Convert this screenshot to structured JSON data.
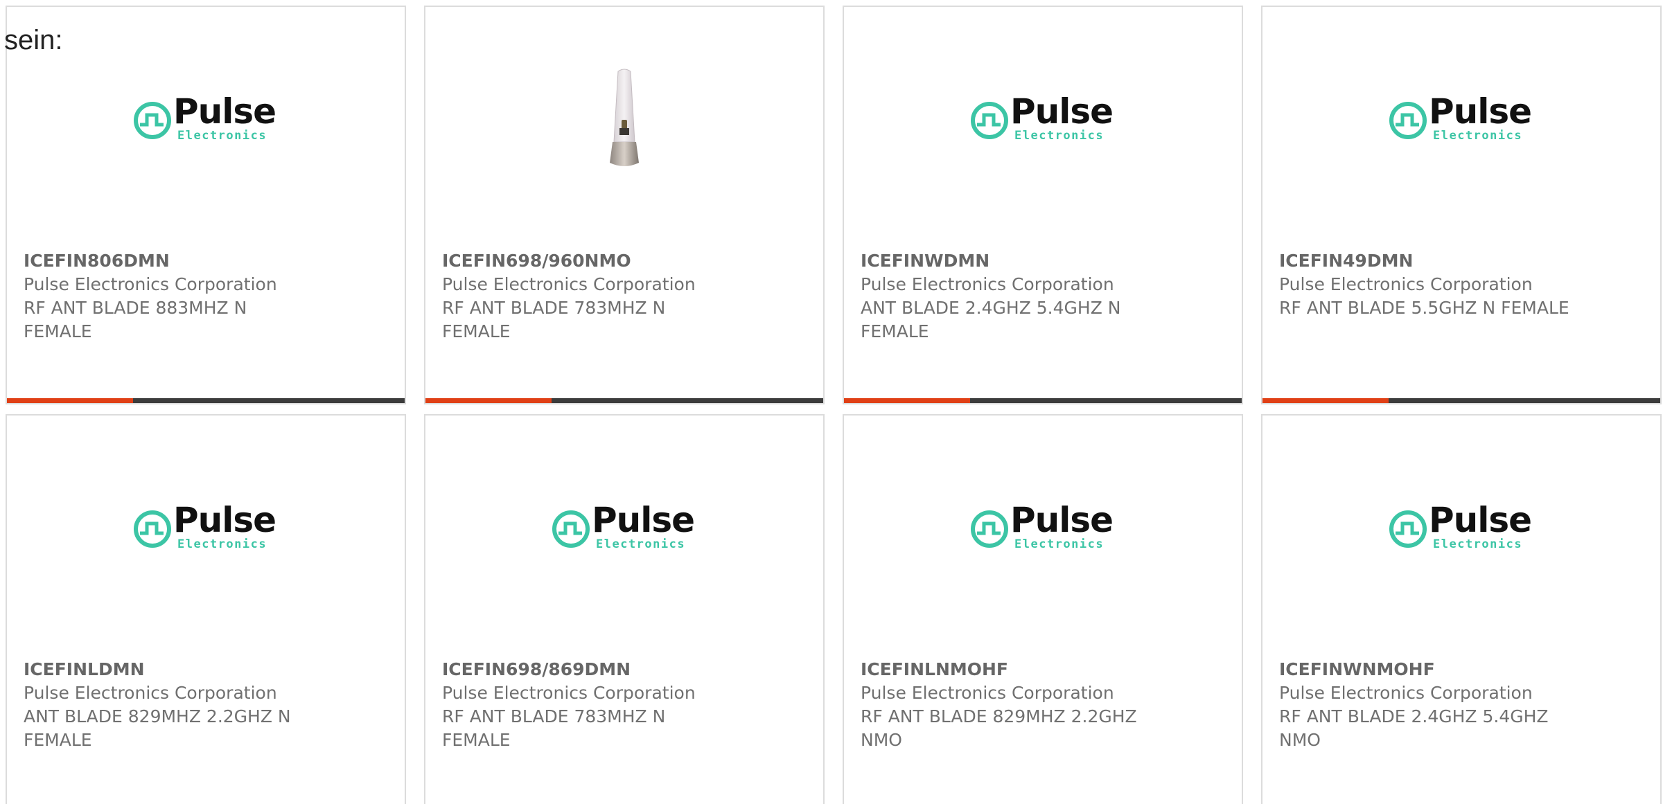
{
  "intro_text": "sein:",
  "brand": {
    "logo_word": "Pulse",
    "logo_sub": "Electronics",
    "logo_color": "#3cc5a5"
  },
  "accent_color": "#e04016",
  "bar_color": "#3c3c3c",
  "products": [
    {
      "part_number": "ICEFIN806DMN",
      "manufacturer": "Pulse Electronics Corporation",
      "description": "RF ANT BLADE 883MHZ N FEMALE",
      "image": "pulse-logo"
    },
    {
      "part_number": "ICEFIN698/960NMO",
      "manufacturer": "Pulse Electronics Corporation",
      "description": "RF ANT BLADE 783MHZ N FEMALE",
      "image": "antenna-photo"
    },
    {
      "part_number": "ICEFINWDMN",
      "manufacturer": "Pulse Electronics Corporation",
      "description": "ANT BLADE 2.4GHZ 5.4GHZ N FEMALE",
      "image": "pulse-logo"
    },
    {
      "part_number": "ICEFIN49DMN",
      "manufacturer": "Pulse Electronics Corporation",
      "description": "RF ANT BLADE 5.5GHZ N FEMALE",
      "image": "pulse-logo"
    },
    {
      "part_number": "ICEFINLDMN",
      "manufacturer": "Pulse Electronics Corporation",
      "description": "ANT BLADE 829MHZ 2.2GHZ N FEMALE",
      "image": "pulse-logo"
    },
    {
      "part_number": "ICEFIN698/869DMN",
      "manufacturer": "Pulse Electronics Corporation",
      "description": "RF ANT BLADE 783MHZ N FEMALE",
      "image": "pulse-logo"
    },
    {
      "part_number": "ICEFINLNMOHF",
      "manufacturer": "Pulse Electronics Corporation",
      "description": "RF ANT BLADE 829MHZ 2.2GHZ NMO",
      "image": "pulse-logo"
    },
    {
      "part_number": "ICEFINWNMOHF",
      "manufacturer": "Pulse Electronics Corporation",
      "description": "RF ANT BLADE 2.4GHZ 5.4GHZ NMO",
      "image": "pulse-logo"
    }
  ]
}
